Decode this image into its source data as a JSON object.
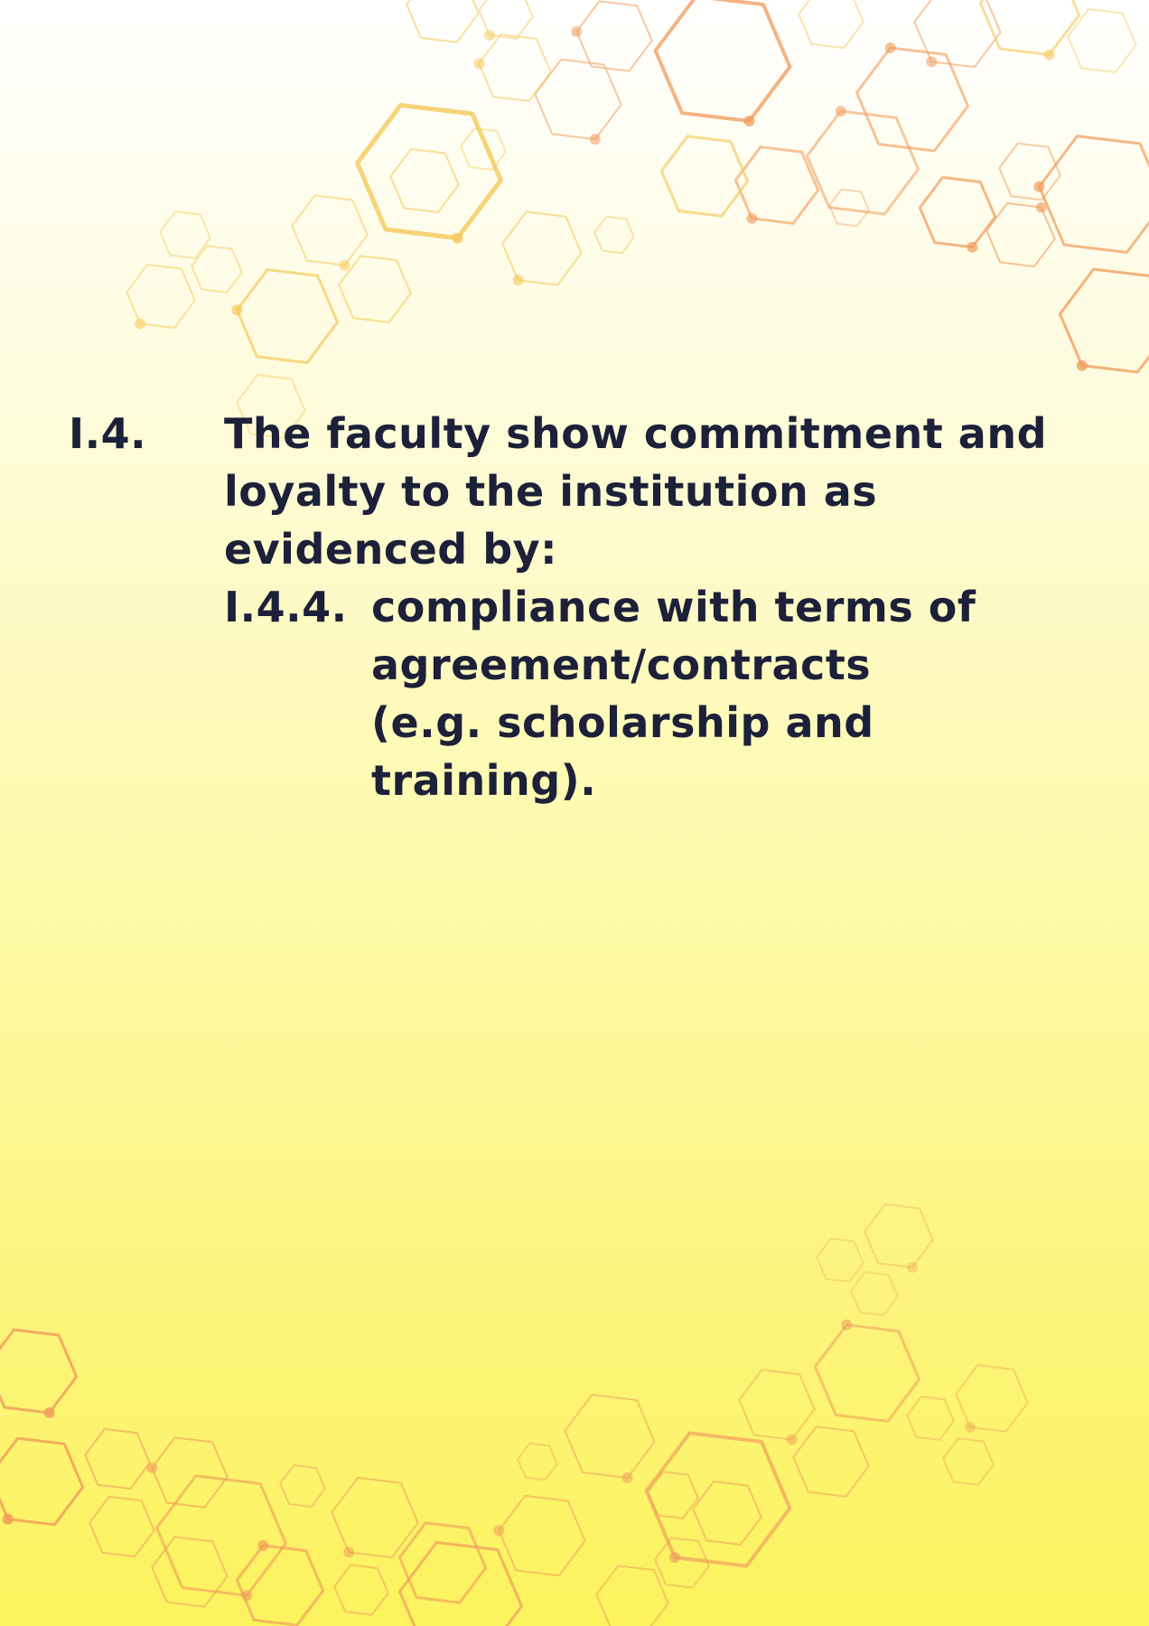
{
  "section": {
    "number": "I.4.",
    "statement": "The faculty show commitment and loyalty to the institution as evidenced by:",
    "subitem": {
      "number": "I.4.4.",
      "text": "compliance with terms of agreement/contracts (e.g. scholarship and training)."
    }
  },
  "colors": {
    "text": "#1c2039",
    "hex_orange": "#f09a5a",
    "hex_yellow": "#f5c85a",
    "background_top": "#ffffff",
    "background_bottom": "#fcf35e"
  }
}
